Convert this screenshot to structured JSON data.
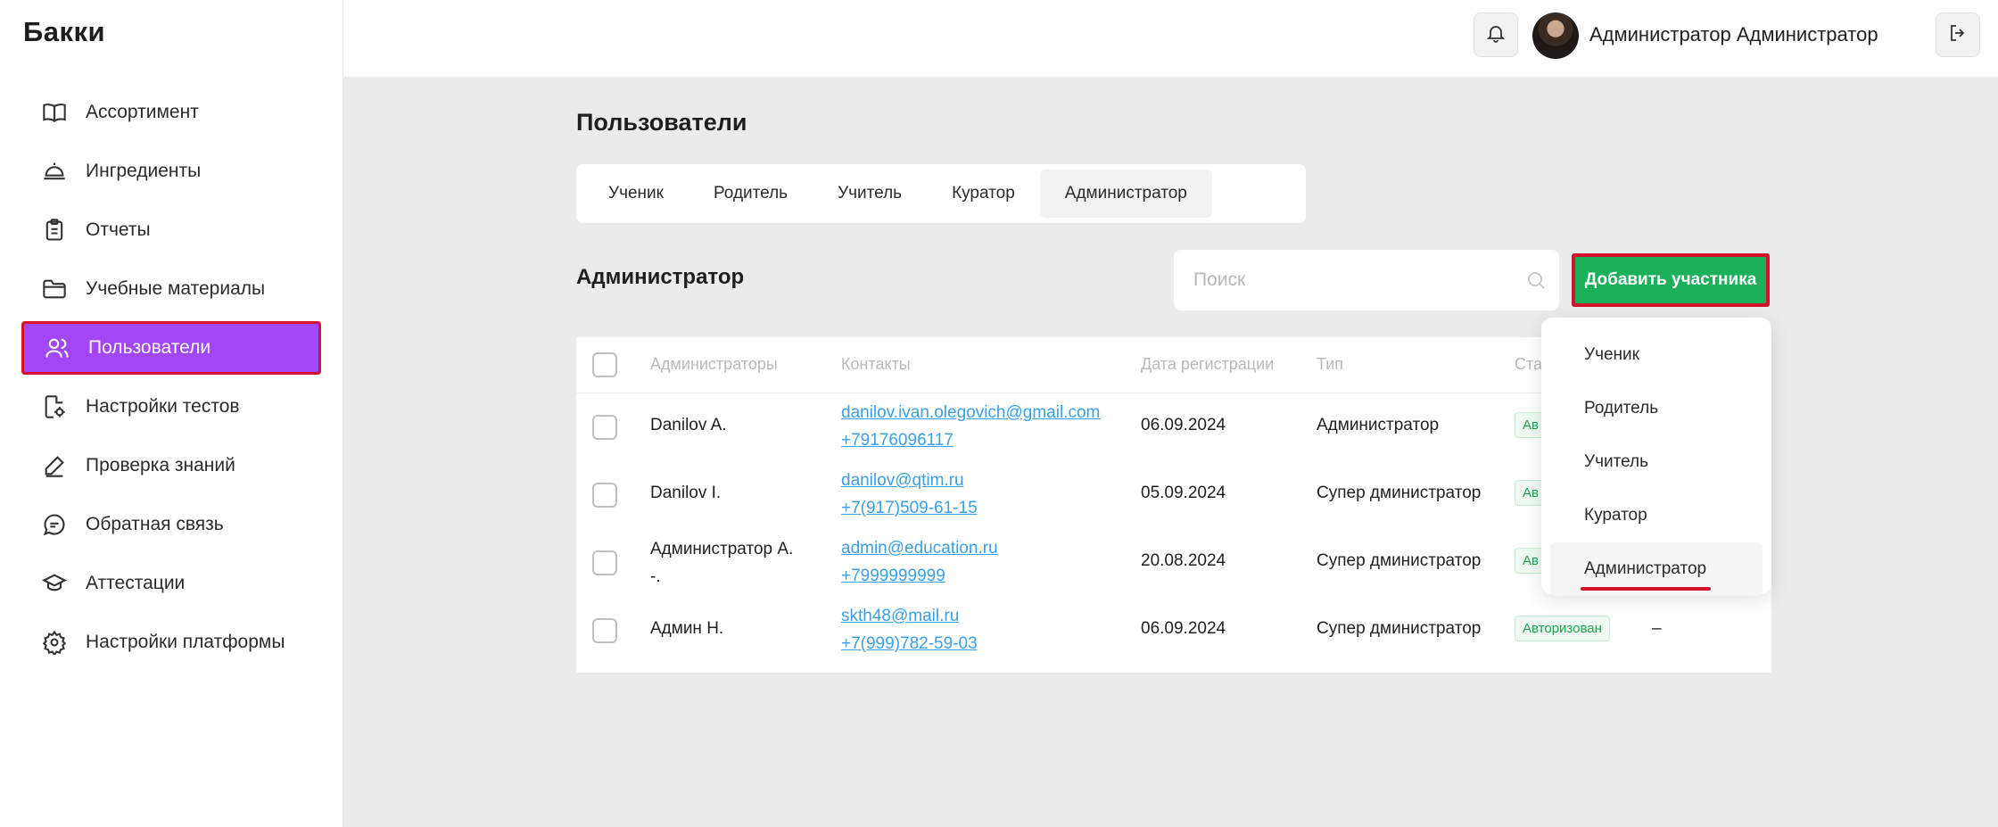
{
  "app": {
    "logo": "Бакки"
  },
  "sidebar": {
    "items": [
      {
        "label": "Ассортимент",
        "icon": "book-icon"
      },
      {
        "label": "Ингредиенты",
        "icon": "cloche-icon"
      },
      {
        "label": "Отчеты",
        "icon": "clipboard-icon"
      },
      {
        "label": "Учебные материалы",
        "icon": "folder-icon"
      },
      {
        "label": "Пользователи",
        "icon": "users-icon",
        "active": true
      },
      {
        "label": "Настройки тестов",
        "icon": "doc-settings-icon"
      },
      {
        "label": "Проверка знаний",
        "icon": "pencil-icon"
      },
      {
        "label": "Обратная связь",
        "icon": "chat-icon"
      },
      {
        "label": "Аттестации",
        "icon": "graduation-cap-icon"
      },
      {
        "label": "Настройки платформы",
        "icon": "gear-icon"
      }
    ]
  },
  "header": {
    "user_name": "Администратор Администратор",
    "icons": [
      "bell-icon",
      "avatar",
      "logout-icon"
    ]
  },
  "page": {
    "title": "Пользователи",
    "tabs": [
      {
        "label": "Ученик"
      },
      {
        "label": "Родитель"
      },
      {
        "label": "Учитель"
      },
      {
        "label": "Куратор"
      },
      {
        "label": "Администратор",
        "active": true
      }
    ],
    "section_title": "Администратор",
    "search_placeholder": "Поиск",
    "add_button": "Добавить участника"
  },
  "table": {
    "headers": [
      "Администраторы",
      "Контакты",
      "Дата регистрации",
      "Тип",
      "Ста"
    ],
    "rows": [
      {
        "name": "Danilov A.",
        "email": "danilov.ivan.olegovich@gmail.com",
        "phone": "+79176096117",
        "date": "06.09.2024",
        "type": "Администратор",
        "status": "Ав",
        "extra": ""
      },
      {
        "name": "Danilov I.",
        "email": "danilov@qtim.ru",
        "phone": "+7(917)509-61-15",
        "date": "05.09.2024",
        "type": "Супер дминистратор",
        "status": "Ав",
        "extra": ""
      },
      {
        "name_line1": "Администратор А.",
        "name_line2": "-.",
        "email": "admin@education.ru",
        "phone": "+7999999999",
        "date": "20.08.2024",
        "type": "Супер дминистратор",
        "status": "Ав",
        "extra": ""
      },
      {
        "name": "Админ Н.",
        "email": "skth48@mail.ru",
        "phone": "+7(999)782-59-03",
        "date": "06.09.2024",
        "type": "Супер дминистратор",
        "status": "Авторизован",
        "extra": "–"
      }
    ]
  },
  "dropdown": {
    "items": [
      {
        "label": "Ученик"
      },
      {
        "label": "Родитель"
      },
      {
        "label": "Учитель"
      },
      {
        "label": "Куратор"
      },
      {
        "label": "Администратор",
        "selected": true
      }
    ]
  },
  "colors": {
    "accent": "#a346f5",
    "primary_button": "#1ab15a",
    "highlight_border": "#d4102a",
    "link": "#3aa0ea"
  }
}
